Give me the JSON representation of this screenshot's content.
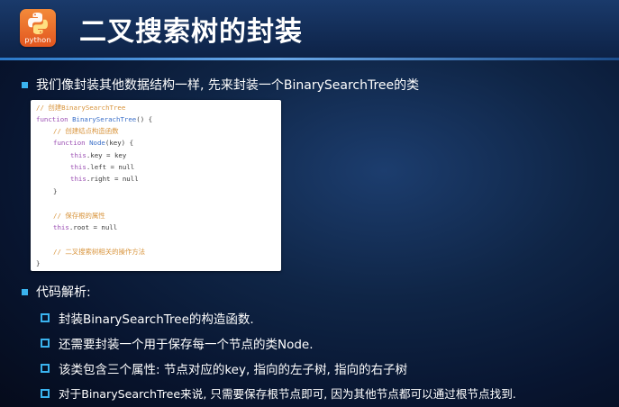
{
  "slide": {
    "logo_label": "python",
    "title": "二叉搜索树的封装",
    "intro": "我们像封装其他数据结构一样, 先来封装一个BinarySearchTree的类",
    "code": {
      "l1": "// 创建BinarySearchTree",
      "l2_kw": "function",
      "l2_fn": "BinarySerachTree",
      "l2_rest": "() {",
      "l3": "// 创建结点构造函数",
      "l4_kw": "function",
      "l4_fn": "Node",
      "l4_rest": "(key) {",
      "l5_kw": "this",
      "l5_rest": ".key = key",
      "l6_kw": "this",
      "l6_rest": ".left = null",
      "l7_kw": "this",
      "l7_rest": ".right = null",
      "l8": "}",
      "l9": "// 保存根的属性",
      "l10_kw": "this",
      "l10_rest": ".root = null",
      "l11": "// 二叉搜索树相关的操作方法",
      "l12": "}"
    },
    "analysis_heading": "代码解析:",
    "points": [
      "封装BinarySearchTree的构造函数.",
      "还需要封装一个用于保存每一个节点的类Node.",
      "该类包含三个属性: 节点对应的key, 指向的左子树, 指向的右子树",
      "对于BinarySearchTree来说, 只需要保存根节点即可, 因为其他节点都可以通过根节点找到."
    ]
  },
  "colors": {
    "accent": "#3ab3ef",
    "logo": "#e2561f",
    "comment": "#d8943c",
    "keyword": "#9b4fb3",
    "function": "#3b6fc8"
  }
}
